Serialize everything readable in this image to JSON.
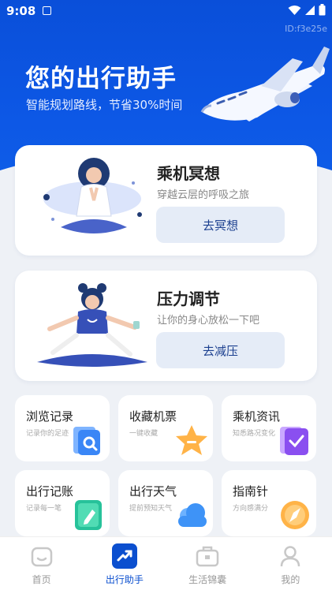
{
  "status_bar": {
    "time": "9:08"
  },
  "hero": {
    "id_tag": "ID:f3e25e",
    "title": "您的出行助手",
    "subtitle": "智能规划路线，节省30%时间"
  },
  "cards": [
    {
      "title": "乘机冥想",
      "desc": "穿越云层的呼吸之旅",
      "button": "去冥想"
    },
    {
      "title": "压力调节",
      "desc": "让你的身心放松一下吧",
      "button": "去减压"
    }
  ],
  "tiles": [
    {
      "title": "浏览记录",
      "sub": "记录你的足迹",
      "icon": "history-icon"
    },
    {
      "title": "收藏机票",
      "sub": "一键收藏",
      "icon": "star-icon"
    },
    {
      "title": "乘机资讯",
      "sub": "知悉路况变化",
      "icon": "checklist-icon"
    },
    {
      "title": "出行记账",
      "sub": "记录每一笔",
      "icon": "ledger-icon"
    },
    {
      "title": "出行天气",
      "sub": "提前预知天气",
      "icon": "cloud-icon"
    },
    {
      "title": "指南针",
      "sub": "方向感满分",
      "icon": "compass-icon"
    }
  ],
  "tabs": [
    {
      "label": "首页",
      "icon": "home-icon"
    },
    {
      "label": "出行助手",
      "icon": "trend-icon"
    },
    {
      "label": "生活锦囊",
      "icon": "briefcase-icon"
    },
    {
      "label": "我的",
      "icon": "profile-icon"
    }
  ],
  "colors": {
    "brand": "#0d58e6",
    "button_bg": "#e5ecf7",
    "button_text": "#1b3f8f"
  }
}
